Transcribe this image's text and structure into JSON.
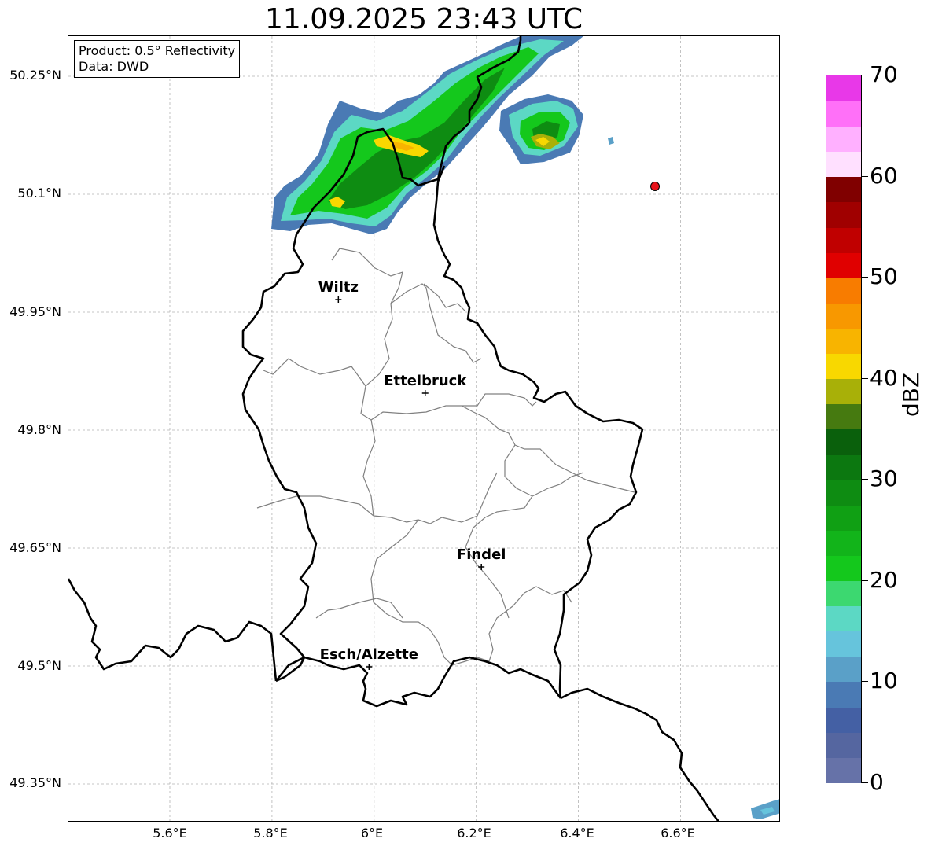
{
  "title": "11.09.2025 23:43 UTC",
  "info": {
    "product": "Product: 0.5° Reflectivity",
    "data_source": "Data: DWD"
  },
  "axes": {
    "lat_ticks": [
      "50.25°N",
      "50.1°N",
      "49.95°N",
      "49.8°N",
      "49.65°N",
      "49.5°N",
      "49.35°N"
    ],
    "lon_ticks": [
      "5.6°E",
      "5.8°E",
      "6°E",
      "6.2°E",
      "6.4°E",
      "6.6°E"
    ]
  },
  "cities": [
    {
      "name": "Wiltz",
      "lon": 5.93,
      "lat": 49.966
    },
    {
      "name": "Ettelbruck",
      "lon": 6.1,
      "lat": 49.847
    },
    {
      "name": "Findel",
      "lon": 6.21,
      "lat": 49.626
    },
    {
      "name": "Esch/Alzette",
      "lon": 5.99,
      "lat": 49.499
    }
  ],
  "radar_marker": {
    "lon": 6.55,
    "lat": 50.11,
    "color": "#e8141b"
  },
  "colorbar": {
    "label": "dBZ",
    "min": 0,
    "max": 70,
    "tick_labels": [
      "0",
      "10",
      "20",
      "30",
      "40",
      "50",
      "60",
      "70"
    ],
    "colors": [
      "#6672a8",
      "#5566a0",
      "#4460a4",
      "#4a7ab4",
      "#5aa0c8",
      "#66c4dc",
      "#5cd8c4",
      "#3cd870",
      "#14c81c",
      "#12b41a",
      "#10a014",
      "#0e8c12",
      "#0c7810",
      "#0a600c",
      "#467a10",
      "#a8b008",
      "#f8d800",
      "#f8b400",
      "#f89800",
      "#f87c00",
      "#e00000",
      "#c00000",
      "#a00000",
      "#800000",
      "#ffe0ff",
      "#ffb0ff",
      "#ff70f8",
      "#e838e8"
    ]
  },
  "colors": {
    "border": "#000000",
    "cantons": "#808080",
    "grid": "#b4b4b4"
  }
}
